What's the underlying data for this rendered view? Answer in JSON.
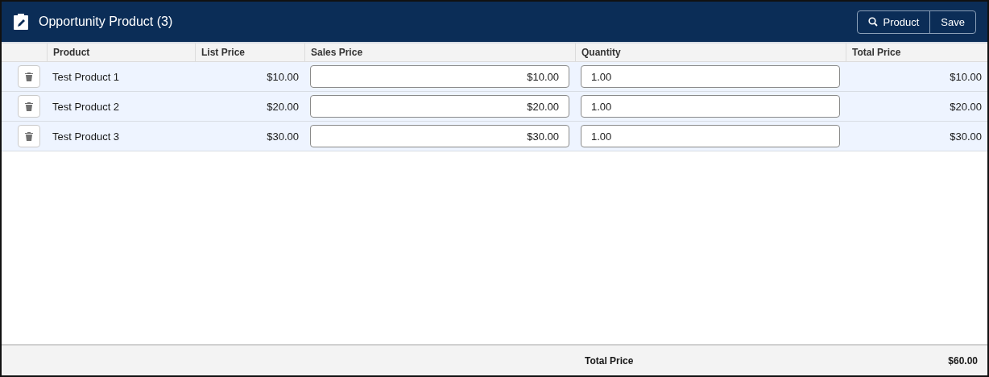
{
  "header": {
    "title": "Opportunity Product (3)",
    "buttons": [
      {
        "kind": "search",
        "label": "Product"
      },
      {
        "kind": "plain",
        "label": "Save"
      }
    ]
  },
  "table": {
    "columns": [
      "Product",
      "List Price",
      "Sales Price",
      "Quantity",
      "Total Price"
    ],
    "rows": [
      {
        "product": "Test Product 1",
        "list_price": "$10.00",
        "sales_price": "$10.00",
        "quantity": "1.00",
        "total_price": "$10.00"
      },
      {
        "product": "Test Product 2",
        "list_price": "$20.00",
        "sales_price": "$20.00",
        "quantity": "1.00",
        "total_price": "$20.00"
      },
      {
        "product": "Test Product 3",
        "list_price": "$30.00",
        "sales_price": "$30.00",
        "quantity": "1.00",
        "total_price": "$30.00"
      }
    ]
  },
  "footer": {
    "label": "Total Price",
    "value": "$60.00"
  }
}
